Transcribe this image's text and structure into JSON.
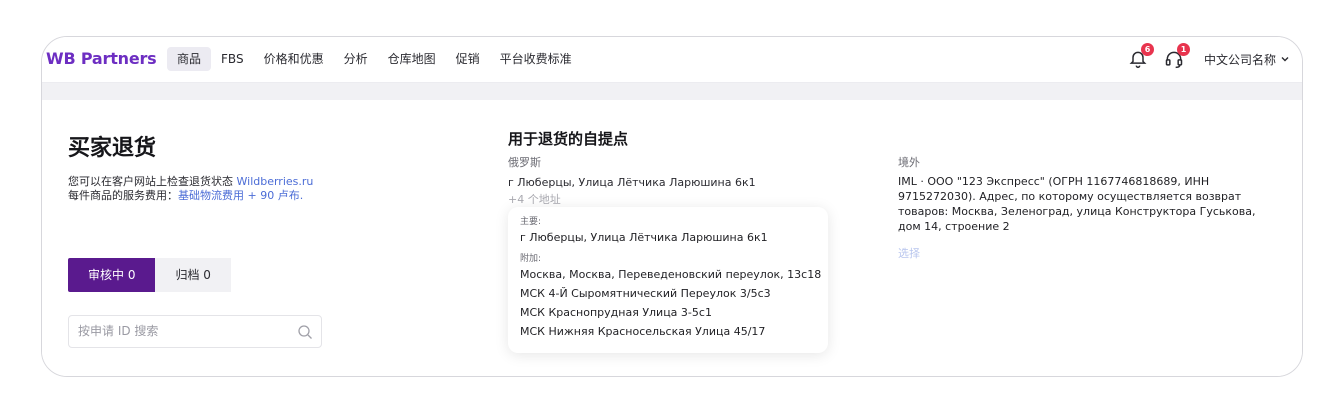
{
  "header": {
    "logo": "WB Partners",
    "nav": [
      "商品",
      "FBS",
      "价格和优惠",
      "分析",
      "仓库地图",
      "促销",
      "平台收费标准"
    ],
    "active_nav_index": 0,
    "notifications_count": "6",
    "support_count": "1",
    "company_name": "中文公司名称"
  },
  "page": {
    "title": "买家退货",
    "info_line1_prefix": "您可以在客户网站上检查退货状态 ",
    "info_line1_link": "Wildberries.ru",
    "info_line2_prefix": "每件商品的服务费用：",
    "info_line2_link": "基础物流费用 + 90 卢布."
  },
  "tabs": {
    "review": "审核中 0",
    "archive": "归档 0"
  },
  "search": {
    "placeholder": "按申请 ID 搜索"
  },
  "pickup": {
    "title": "用于退货的自提点",
    "russia_label": "俄罗斯",
    "russia_address": "г Люберцы, Улица Лётчика Ларюшина 6к1",
    "more_addresses": "+4 个地址",
    "popup": {
      "main_label": "主要:",
      "main_address": "г Люберцы, Улица Лётчика Ларюшина 6к1",
      "extra_label": "附加:",
      "extra_addresses": [
        "Москва, Москва, Переведеновский переулок, 13с18",
        "МСК 4-Й Сыромятнический Переулок 3/5с3",
        "МСК Краснопрудная Улица 3-5с1",
        "МСК Нижняя Красносельская Улица 45/17"
      ]
    },
    "abroad_label": "境外",
    "abroad_text": "IML · ООО \"123 Экспресс\" (ОГРН 1167746818689, ИНН 9715272030). Адрес, по которому осуществляется возврат товаров: Москва, Зеленоград, улица Конструктора Гуськова, дом 14, строение 2",
    "choose": "选择"
  },
  "colors": {
    "brand": "#6d2ec2",
    "active_tab": "#5a1a8e",
    "badge": "#e8344e",
    "link": "#4b6cd6"
  },
  "icons": [
    "bell-icon",
    "support-headset-icon",
    "chevron-down-icon",
    "search-icon"
  ]
}
